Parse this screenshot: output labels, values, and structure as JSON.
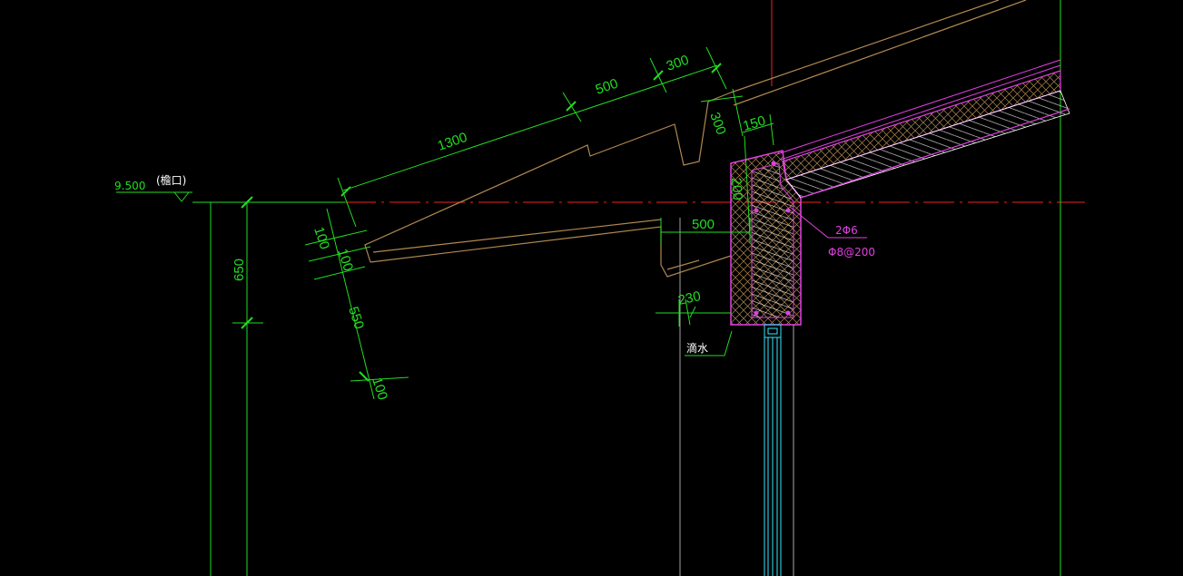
{
  "colors": {
    "background": "#000000",
    "dimension": "#22dd22",
    "outline": "#b08850",
    "structure": "#e040e0",
    "centerline": "#ee2222",
    "window": "#33e8ff",
    "detail": "#ffffff"
  },
  "labels": {
    "elevation": "9.500",
    "elevation_note": "(檐口)",
    "drip": "滴水",
    "rebar_main": "2Φ6",
    "rebar_stirrup": "Φ8@200"
  },
  "dimensions": {
    "d1300": "1300",
    "d500_top": "500",
    "d300_top": "300",
    "d300_vert": "300",
    "d150": "150",
    "d200": "200",
    "d500_mid": "500",
    "d230": "230",
    "d650": "650",
    "d100_a": "100",
    "d100_b": "100",
    "d550": "550",
    "d100_c": "100"
  }
}
